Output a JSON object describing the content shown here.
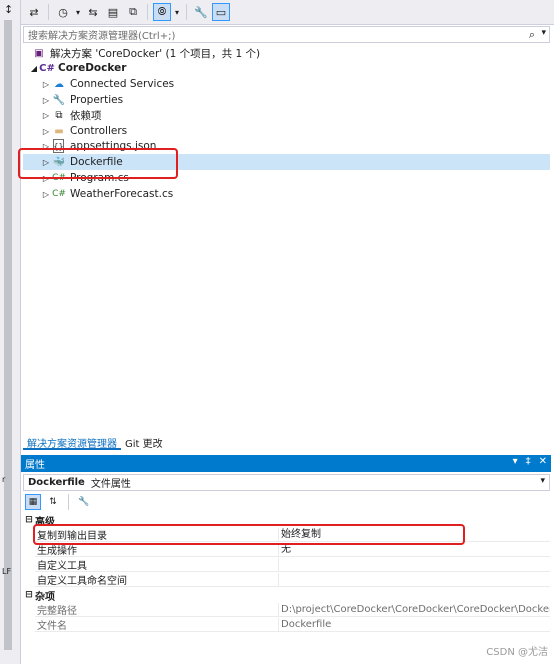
{
  "left_strip": {
    "top_glyph": "↕",
    "labels": [
      "r",
      "LF"
    ]
  },
  "toolbar": {
    "buttons": [
      {
        "name": "sync-icon",
        "glyph": "⇄"
      },
      {
        "name": "history-icon",
        "glyph": "◷"
      },
      {
        "name": "dropdown-icon",
        "glyph": "▾"
      },
      {
        "name": "back-forward-icon",
        "glyph": "⇆"
      },
      {
        "name": "collapse-icon",
        "glyph": "▤"
      },
      {
        "name": "copy-icon",
        "glyph": "⧉"
      },
      {
        "name": "scope-icon",
        "glyph": "⦾"
      },
      {
        "name": "dropdown2-icon",
        "glyph": "▾"
      },
      {
        "name": "wrench-icon",
        "glyph": "🔧"
      },
      {
        "name": "preview-icon",
        "glyph": "▭"
      }
    ]
  },
  "search": {
    "placeholder": "搜索解决方案资源管理器(Ctrl+;)",
    "icon": "⌕",
    "dd": "▾"
  },
  "tree": {
    "solution": "解决方案 'CoreDocker' (1 个项目，共 1 个)",
    "project": "CoreDocker",
    "items": [
      {
        "label": "Connected Services",
        "icon": "☁",
        "color": "#1e7fd6"
      },
      {
        "label": "Properties",
        "icon": "🔧",
        "color": "#6d6d6d"
      },
      {
        "label": "依赖项",
        "icon": "⧉",
        "color": "#1e1e1e"
      },
      {
        "label": "Controllers",
        "icon": "▬",
        "color": "#dcb67a"
      },
      {
        "label": "appsettings.json",
        "icon": "{}",
        "color": "#1e1e1e"
      },
      {
        "label": "Dockerfile",
        "icon": "🐳",
        "color": "#1e7fd6"
      },
      {
        "label": "Program.cs",
        "icon": "C#",
        "color": "#368832"
      },
      {
        "label": "WeatherForecast.cs",
        "icon": "C#",
        "color": "#368832"
      }
    ]
  },
  "tabs": [
    {
      "label": "解决方案资源管理器",
      "active": true
    },
    {
      "label": "Git 更改",
      "active": false
    }
  ],
  "properties": {
    "title": "属性",
    "controls": [
      "▾",
      "‡",
      "✕"
    ],
    "object_name": "Dockerfile",
    "object_type": "文件属性",
    "categories": [
      {
        "label": "高级",
        "rows": [
          {
            "name": "复制到输出目录",
            "value": "始终复制",
            "readonly": false
          },
          {
            "name": "生成操作",
            "value": "无",
            "readonly": false
          },
          {
            "name": "自定义工具",
            "value": "",
            "readonly": false
          },
          {
            "name": "自定义工具命名空间",
            "value": "",
            "readonly": false
          }
        ]
      },
      {
        "label": "杂项",
        "rows": [
          {
            "name": "完整路径",
            "value": "D:\\project\\CoreDocker\\CoreDocker\\CoreDocker\\Dockerfile",
            "readonly": true
          },
          {
            "name": "文件名",
            "value": "Dockerfile",
            "readonly": true
          }
        ]
      }
    ]
  },
  "watermark": "CSDN @尤洁"
}
